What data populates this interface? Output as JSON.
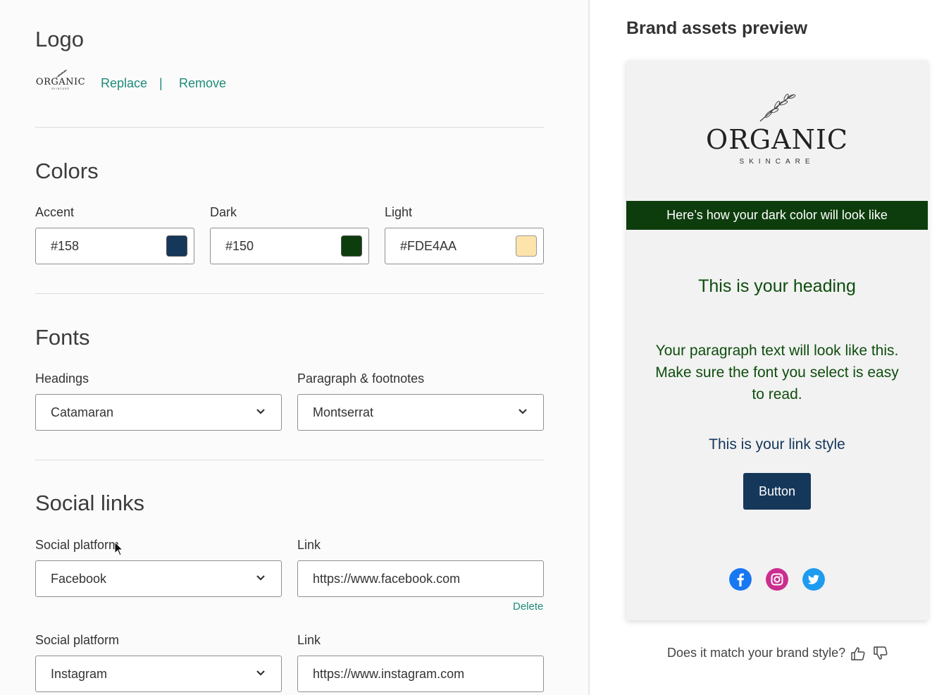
{
  "logo_section": {
    "title": "Logo",
    "logo_word": "ORGANIC",
    "logo_sub": "SKINCARE",
    "replace_label": "Replace",
    "separator": "|",
    "remove_label": "Remove"
  },
  "colors_section": {
    "title": "Colors",
    "fields": [
      {
        "label": "Accent",
        "value": "#158",
        "swatch": "#15375a"
      },
      {
        "label": "Dark",
        "value": "#150",
        "swatch": "#0e3d0d"
      },
      {
        "label": "Light",
        "value": "#FDE4AA",
        "swatch": "#fde4aa"
      }
    ]
  },
  "fonts_section": {
    "title": "Fonts",
    "headings_label": "Headings",
    "headings_value": "Catamaran",
    "paragraph_label": "Paragraph & footnotes",
    "paragraph_value": "Montserrat"
  },
  "social_section": {
    "title": "Social links",
    "rows": [
      {
        "platform_label": "Social platform",
        "platform_value": "Facebook",
        "link_label": "Link",
        "link_value": "https://www.facebook.com",
        "delete_label": "Delete"
      },
      {
        "platform_label": "Social platform",
        "platform_value": "Instagram",
        "link_label": "Link",
        "link_value": "https://www.instagram.com"
      }
    ]
  },
  "preview": {
    "title": "Brand assets preview",
    "logo_word": "ORGANIC",
    "logo_sub": "SKINCARE",
    "dark_band_text": "Here’s how your dark color will look like",
    "heading_text": "This is your heading",
    "paragraph_text": "Your paragraph text will look like this. Make sure the font you select is easy to read.",
    "link_text": "This is your link style",
    "button_label": "Button",
    "social_icons": [
      "facebook-icon",
      "instagram-icon",
      "twitter-icon"
    ],
    "feedback_question": "Does it match your brand style?"
  },
  "colors": {
    "accent": "#15375a",
    "dark": "#0e3d0d",
    "light": "#fde4aa",
    "action_teal": "#1e8a7a"
  }
}
